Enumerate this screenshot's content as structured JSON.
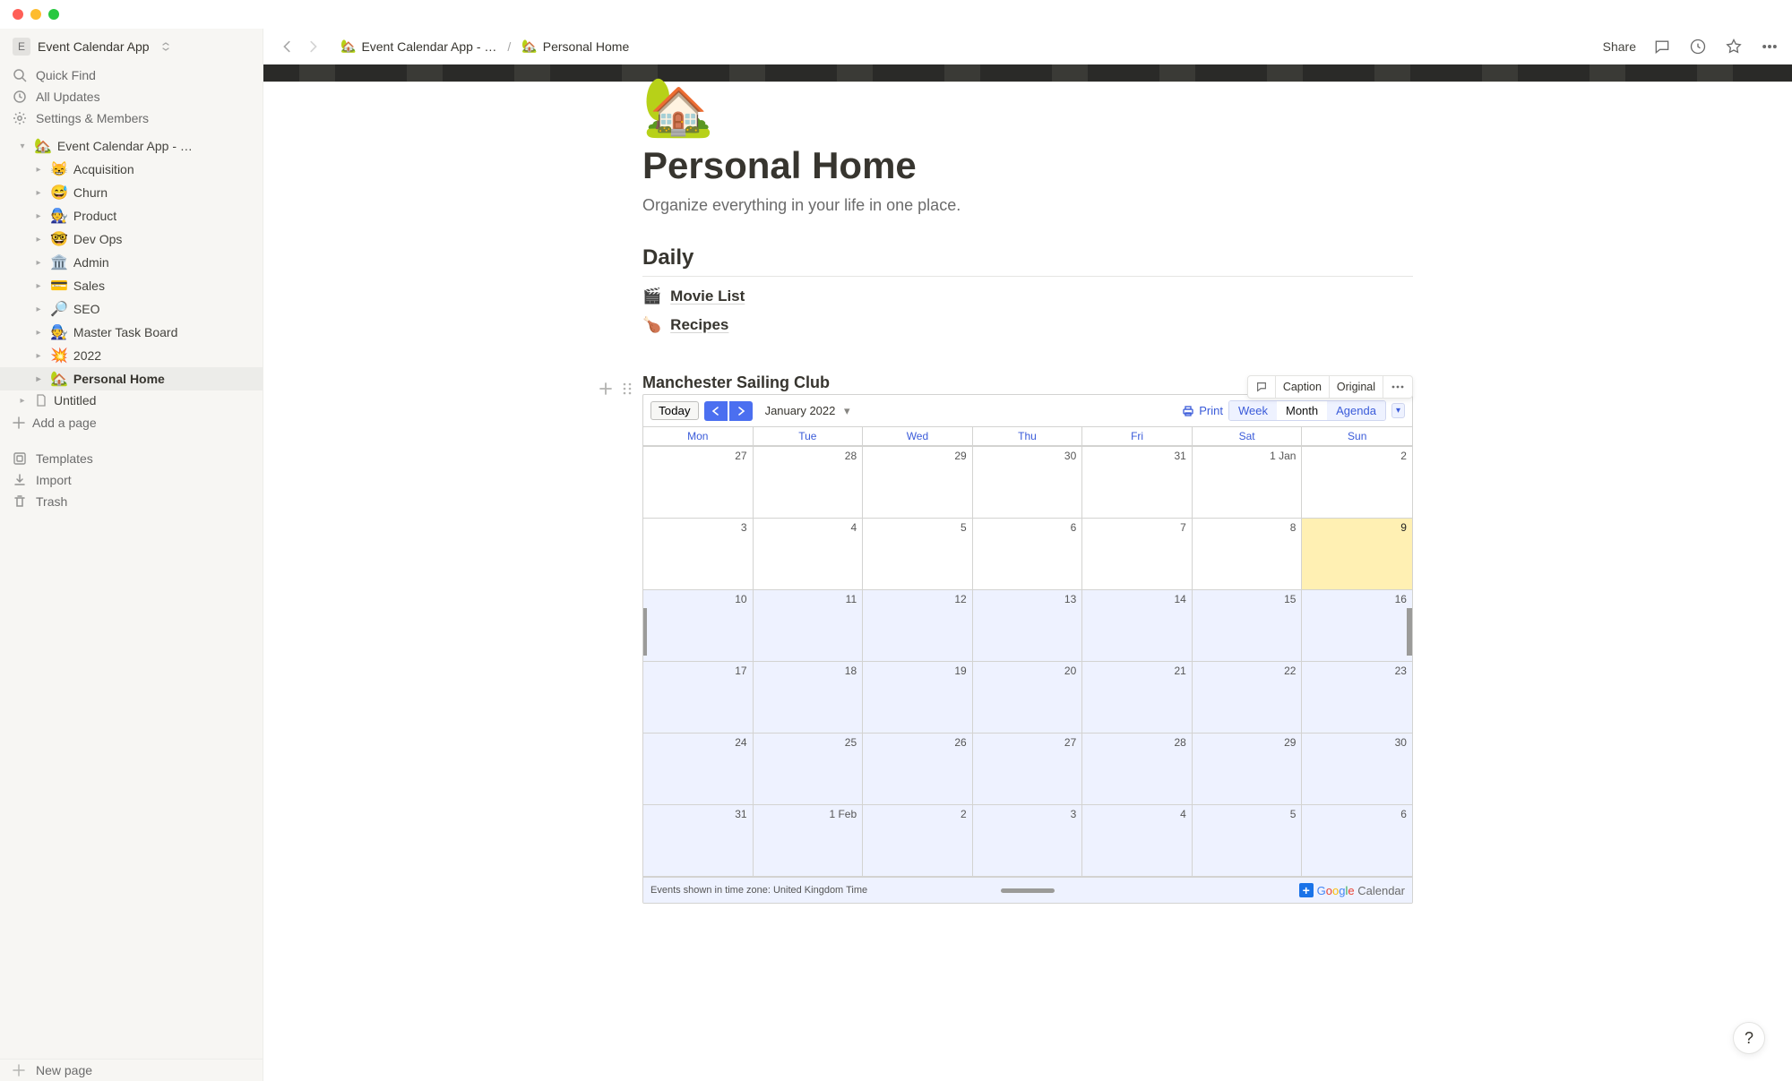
{
  "workspace": {
    "name": "Event Calendar App",
    "badge": "E"
  },
  "topbar": {
    "share": "Share",
    "breadcrumb": [
      {
        "emoji": "🏡",
        "label": "Event Calendar App - …"
      },
      {
        "emoji": "🏡",
        "label": "Personal Home"
      }
    ]
  },
  "sidebar": {
    "quick_find": "Quick Find",
    "all_updates": "All Updates",
    "settings": "Settings & Members",
    "tree_root": {
      "emoji": "🏡",
      "label": "Event Calendar App - …"
    },
    "tree": [
      {
        "emoji": "😸",
        "label": "Acquisition"
      },
      {
        "emoji": "😅",
        "label": "Churn"
      },
      {
        "emoji": "🧑‍🔧",
        "label": "Product"
      },
      {
        "emoji": "🤓",
        "label": "Dev Ops"
      },
      {
        "emoji": "🏛️",
        "label": "Admin"
      },
      {
        "emoji": "💳",
        "label": "Sales"
      },
      {
        "emoji": "🔎",
        "label": "SEO"
      },
      {
        "emoji": "🧑‍🔧",
        "label": "Master Task Board"
      },
      {
        "emoji": "💥",
        "label": "2022"
      },
      {
        "emoji": "🏡",
        "label": "Personal Home",
        "active": true
      }
    ],
    "untitled": "Untitled",
    "add_page": "Add a page",
    "templates": "Templates",
    "import": "Import",
    "trash": "Trash",
    "new_page": "New page"
  },
  "page": {
    "emoji": "🏡",
    "title": "Personal Home",
    "subtitle": "Organize everything in your life in one place.",
    "section_daily": "Daily",
    "links": [
      {
        "emoji": "🎬",
        "label": "Movie List"
      },
      {
        "emoji": "🍗",
        "label": "Recipes"
      }
    ]
  },
  "embed_toolbar": {
    "comment_icon": "comment",
    "caption": "Caption",
    "original": "Original",
    "more": "more"
  },
  "calendar": {
    "title": "Manchester Sailing Club",
    "today": "Today",
    "month_label": "January 2022",
    "print": "Print",
    "views": {
      "week": "Week",
      "month": "Month",
      "agenda": "Agenda"
    },
    "dow": [
      "Mon",
      "Tue",
      "Wed",
      "Thu",
      "Fri",
      "Sat",
      "Sun"
    ],
    "rows": [
      [
        "27",
        "28",
        "29",
        "30",
        "31",
        "1 Jan",
        "2"
      ],
      [
        "3",
        "4",
        "5",
        "6",
        "7",
        "8",
        "9"
      ],
      [
        "10",
        "11",
        "12",
        "13",
        "14",
        "15",
        "16"
      ],
      [
        "17",
        "18",
        "19",
        "20",
        "21",
        "22",
        "23"
      ],
      [
        "24",
        "25",
        "26",
        "27",
        "28",
        "29",
        "30"
      ],
      [
        "31",
        "1 Feb",
        "2",
        "3",
        "4",
        "5",
        "6"
      ]
    ],
    "today_cell": [
      1,
      6
    ],
    "timezone": "Events shown in time zone: United Kingdom Time",
    "google": "Google",
    "google_suffix": "Calendar"
  },
  "help": "?"
}
